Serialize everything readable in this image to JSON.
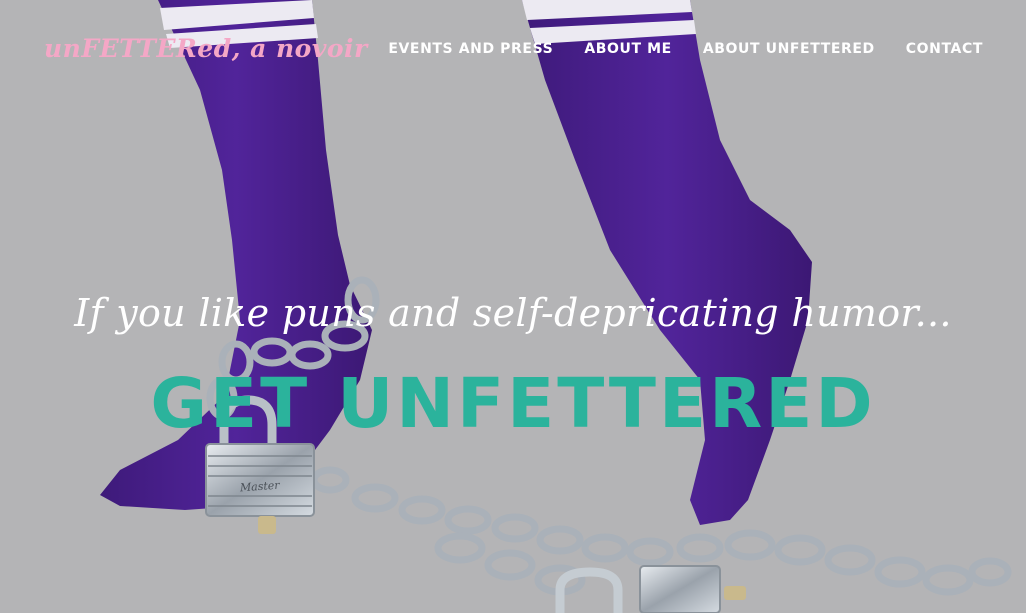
{
  "site": {
    "logo_text": "unFETTERed, a novoir"
  },
  "nav": {
    "items": [
      {
        "label": "EVENTS AND PRESS"
      },
      {
        "label": "ABOUT ME"
      },
      {
        "label": "ABOUT UNFETTERED"
      },
      {
        "label": "CONTACT"
      }
    ]
  },
  "hero": {
    "tagline": "If you like puns and self-depricating humor...",
    "headline": "GET UNFETTERED",
    "padlock_brand": "Master"
  },
  "colors": {
    "background": "#b4b4b6",
    "logo_pink": "#f4a7c6",
    "accent_teal": "#2bb39c",
    "sock_purple": "#4b1f8f",
    "nav_text": "#ffffff"
  }
}
